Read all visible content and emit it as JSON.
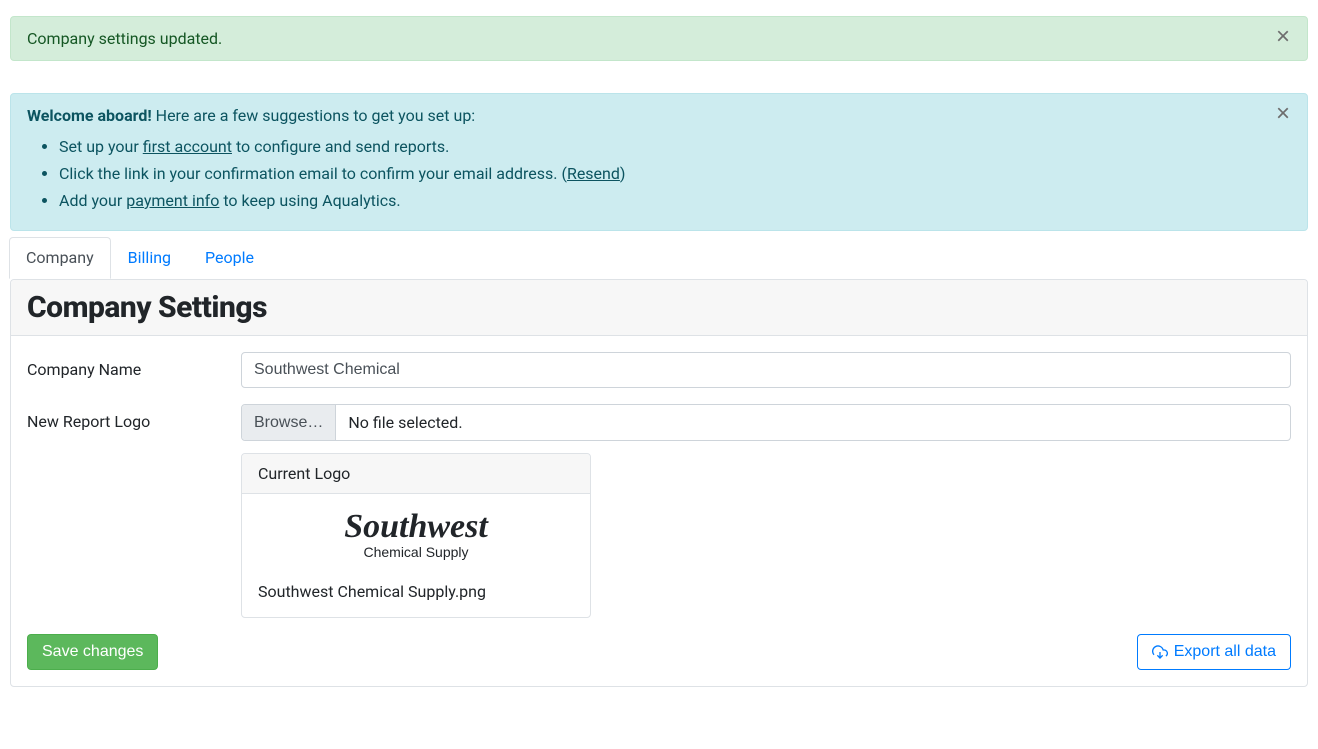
{
  "alerts": {
    "success": {
      "text": "Company settings updated."
    },
    "welcome": {
      "bold": "Welcome aboard!",
      "lead": " Here are a few suggestions to get you set up:",
      "item1_pre": "Set up your ",
      "item1_link": "first account",
      "item1_post": " to configure and send reports.",
      "item2_pre": "Click the link in your confirmation email to confirm your email address. (",
      "item2_link": "Resend",
      "item2_post": ")",
      "item3_pre": "Add your ",
      "item3_link": "payment info",
      "item3_post": " to keep using Aqualytics."
    }
  },
  "tabs": {
    "company": "Company",
    "billing": "Billing",
    "people": "People"
  },
  "page": {
    "title": "Company Settings"
  },
  "form": {
    "company_name_label": "Company Name",
    "company_name_value": "Southwest Chemical",
    "logo_label": "New Report Logo",
    "browse_label": "Browse…",
    "file_status": "No file selected.",
    "current_logo_header": "Current Logo",
    "logo_text_main": "Southwest",
    "logo_text_sub": "Chemical Supply",
    "logo_filename": "Southwest Chemical Supply.png"
  },
  "buttons": {
    "save": "Save changes",
    "export": "Export all data"
  }
}
